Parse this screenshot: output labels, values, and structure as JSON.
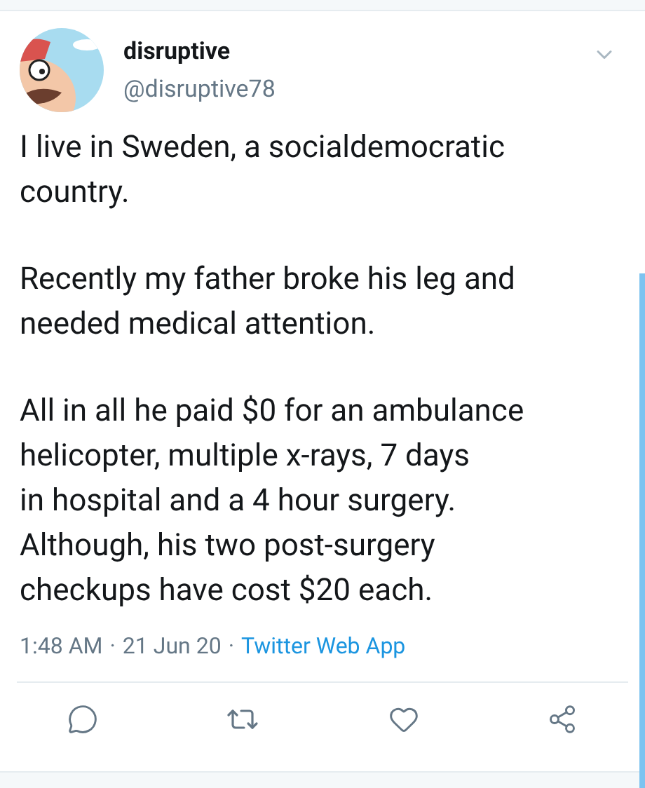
{
  "tweet": {
    "name": "disruptive",
    "handle": "@disruptive78",
    "paragraphs": [
      "I live in Sweden, a socialdemocratic\ncountry.",
      "Recently my father broke his leg and\nneeded medical attention.",
      "All in all he paid $0 for an ambulance\nhelicopter, multiple x-rays, 7 days\nin hospital and a 4 hour surgery.\nAlthough, his two post-surgery\ncheckups have cost $20 each."
    ],
    "time": "1:48 AM",
    "separator": "·",
    "date": "21 Jun 20",
    "separator_2": "·",
    "source": "Twitter Web App"
  }
}
